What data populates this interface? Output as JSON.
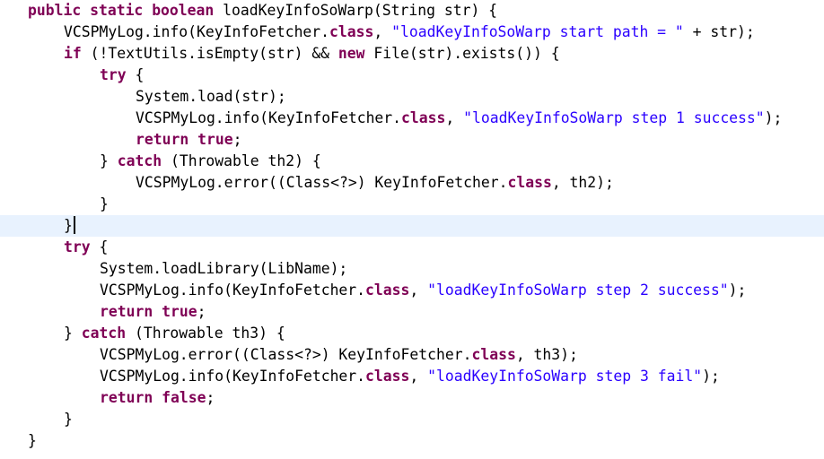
{
  "editor": {
    "current_line_index": 10,
    "lines": [
      {
        "indent": 0,
        "tokens": [
          {
            "t": "kw",
            "v": "public"
          },
          {
            "t": "p",
            "v": " "
          },
          {
            "t": "kw",
            "v": "static"
          },
          {
            "t": "p",
            "v": " "
          },
          {
            "t": "kw",
            "v": "boolean"
          },
          {
            "t": "p",
            "v": " loadKeyInfoSoWarp(String str) {"
          }
        ]
      },
      {
        "indent": 1,
        "tokens": [
          {
            "t": "p",
            "v": "VCSPMyLog.info(KeyInfoFetcher."
          },
          {
            "t": "kw",
            "v": "class"
          },
          {
            "t": "p",
            "v": ", "
          },
          {
            "t": "s",
            "v": "\"loadKeyInfoSoWarp start path = \""
          },
          {
            "t": "p",
            "v": " + str);"
          }
        ]
      },
      {
        "indent": 1,
        "tokens": [
          {
            "t": "kw",
            "v": "if"
          },
          {
            "t": "p",
            "v": " (!TextUtils.isEmpty(str) && "
          },
          {
            "t": "kw",
            "v": "new"
          },
          {
            "t": "p",
            "v": " File(str).exists()) {"
          }
        ]
      },
      {
        "indent": 2,
        "tokens": [
          {
            "t": "kw",
            "v": "try"
          },
          {
            "t": "p",
            "v": " {"
          }
        ]
      },
      {
        "indent": 3,
        "tokens": [
          {
            "t": "p",
            "v": "System.load(str);"
          }
        ]
      },
      {
        "indent": 3,
        "tokens": [
          {
            "t": "p",
            "v": "VCSPMyLog.info(KeyInfoFetcher."
          },
          {
            "t": "kw",
            "v": "class"
          },
          {
            "t": "p",
            "v": ", "
          },
          {
            "t": "s",
            "v": "\"loadKeyInfoSoWarp step 1 success\""
          },
          {
            "t": "p",
            "v": ");"
          }
        ]
      },
      {
        "indent": 3,
        "tokens": [
          {
            "t": "kw",
            "v": "return"
          },
          {
            "t": "p",
            "v": " "
          },
          {
            "t": "kw",
            "v": "true"
          },
          {
            "t": "p",
            "v": ";"
          }
        ]
      },
      {
        "indent": 2,
        "tokens": [
          {
            "t": "p",
            "v": "} "
          },
          {
            "t": "kw",
            "v": "catch"
          },
          {
            "t": "p",
            "v": " (Throwable th2) {"
          }
        ]
      },
      {
        "indent": 3,
        "tokens": [
          {
            "t": "p",
            "v": "VCSPMyLog.error((Class<?>) KeyInfoFetcher."
          },
          {
            "t": "kw",
            "v": "class"
          },
          {
            "t": "p",
            "v": ", th2);"
          }
        ]
      },
      {
        "indent": 2,
        "tokens": [
          {
            "t": "p",
            "v": "}"
          }
        ]
      },
      {
        "indent": 1,
        "tokens": [
          {
            "t": "p",
            "v": "}"
          }
        ]
      },
      {
        "indent": 1,
        "tokens": [
          {
            "t": "kw",
            "v": "try"
          },
          {
            "t": "p",
            "v": " {"
          }
        ]
      },
      {
        "indent": 2,
        "tokens": [
          {
            "t": "p",
            "v": "System.loadLibrary(LibName);"
          }
        ]
      },
      {
        "indent": 2,
        "tokens": [
          {
            "t": "p",
            "v": "VCSPMyLog.info(KeyInfoFetcher."
          },
          {
            "t": "kw",
            "v": "class"
          },
          {
            "t": "p",
            "v": ", "
          },
          {
            "t": "s",
            "v": "\"loadKeyInfoSoWarp step 2 success\""
          },
          {
            "t": "p",
            "v": ");"
          }
        ]
      },
      {
        "indent": 2,
        "tokens": [
          {
            "t": "kw",
            "v": "return"
          },
          {
            "t": "p",
            "v": " "
          },
          {
            "t": "kw",
            "v": "true"
          },
          {
            "t": "p",
            "v": ";"
          }
        ]
      },
      {
        "indent": 1,
        "tokens": [
          {
            "t": "p",
            "v": "} "
          },
          {
            "t": "kw",
            "v": "catch"
          },
          {
            "t": "p",
            "v": " (Throwable th3) {"
          }
        ]
      },
      {
        "indent": 2,
        "tokens": [
          {
            "t": "p",
            "v": "VCSPMyLog.error((Class<?>) KeyInfoFetcher."
          },
          {
            "t": "kw",
            "v": "class"
          },
          {
            "t": "p",
            "v": ", th3);"
          }
        ]
      },
      {
        "indent": 2,
        "tokens": [
          {
            "t": "p",
            "v": "VCSPMyLog.info(KeyInfoFetcher."
          },
          {
            "t": "kw",
            "v": "class"
          },
          {
            "t": "p",
            "v": ", "
          },
          {
            "t": "s",
            "v": "\"loadKeyInfoSoWarp step 3 fail\""
          },
          {
            "t": "p",
            "v": ");"
          }
        ]
      },
      {
        "indent": 2,
        "tokens": [
          {
            "t": "kw",
            "v": "return"
          },
          {
            "t": "p",
            "v": " "
          },
          {
            "t": "kw",
            "v": "false"
          },
          {
            "t": "p",
            "v": ";"
          }
        ]
      },
      {
        "indent": 1,
        "tokens": [
          {
            "t": "p",
            "v": "}"
          }
        ]
      },
      {
        "indent": 0,
        "tokens": [
          {
            "t": "p",
            "v": "}"
          }
        ]
      }
    ]
  },
  "colors": {
    "keyword": "#7f0055",
    "string": "#2a00ff",
    "plain": "#000000",
    "current_line_highlight": "#e8f2fe",
    "background": "#ffffff"
  }
}
